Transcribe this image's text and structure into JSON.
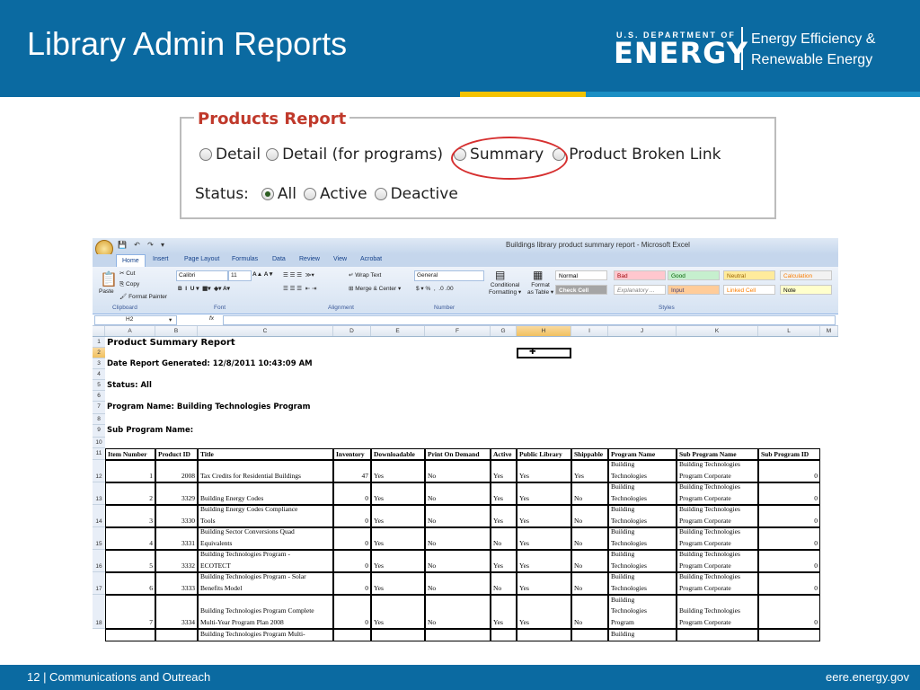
{
  "slide": {
    "title": "Library Admin Reports",
    "logo_small": "U.S. DEPARTMENT OF",
    "logo_big": "ENERGY",
    "eere_line1": "Energy Efficiency &",
    "eere_line2": "Renewable Energy",
    "footer_left": "12 | Communications and Outreach",
    "footer_right": "eere.energy.gov"
  },
  "products_report": {
    "legend": "Products Report",
    "options": [
      "Detail",
      "Detail (for programs)",
      "Summary",
      "Product Broken Link"
    ],
    "status_label": "Status:",
    "status_options": [
      "All",
      "Active",
      "Deactive"
    ],
    "selected_status": "All"
  },
  "excel": {
    "window_title": "Buildings library product summary report - Microsoft Excel",
    "tabs": [
      "Home",
      "Insert",
      "Page Layout",
      "Formulas",
      "Data",
      "Review",
      "View",
      "Acrobat"
    ],
    "ribbon": {
      "paste": "Paste",
      "cut": "Cut",
      "copy": "Copy",
      "format_painter": "Format Painter",
      "font_name": "Calibri",
      "font_size": "11",
      "wrap_text": "Wrap Text",
      "merge_center": "Merge & Center",
      "number_format": "General",
      "conditional": "Conditional",
      "formatting": "Formatting",
      "format": "Format",
      "as_table": "as Table",
      "groups": [
        "Clipboard",
        "Font",
        "Alignment",
        "Number",
        "Styles"
      ],
      "styles": [
        {
          "label": "Normal",
          "bg": "#ffffff",
          "fg": "#000000"
        },
        {
          "label": "Bad",
          "bg": "#ffc7ce",
          "fg": "#9c0006"
        },
        {
          "label": "Good",
          "bg": "#c6efce",
          "fg": "#006100"
        },
        {
          "label": "Neutral",
          "bg": "#ffeb9c",
          "fg": "#9c6500"
        },
        {
          "label": "Calculation",
          "bg": "#f2f2f2",
          "fg": "#fa7d00"
        },
        {
          "label": "Check Cell",
          "bg": "#a5a5a5",
          "fg": "#ffffff"
        },
        {
          "label": "Explanatory ...",
          "bg": "#ffffff",
          "fg": "#7f7f7f"
        },
        {
          "label": "Input",
          "bg": "#ffcc99",
          "fg": "#3f3f76"
        },
        {
          "label": "Linked Cell",
          "bg": "#ffffff",
          "fg": "#fa7d00"
        },
        {
          "label": "Note",
          "bg": "#ffffcc",
          "fg": "#000000"
        }
      ]
    },
    "name_box": "H2",
    "fx": "fx",
    "columns": [
      "A",
      "B",
      "C",
      "D",
      "E",
      "F",
      "G",
      "H",
      "I",
      "J",
      "K",
      "L",
      "M"
    ],
    "selected_column": "H",
    "row_numbers": [
      "1",
      "2",
      "3",
      "4",
      "5",
      "6",
      "7",
      "8",
      "9",
      "10",
      "11",
      "12",
      "13",
      "14",
      "15",
      "16",
      "17",
      "18"
    ],
    "report_title": "Product Summary Report",
    "date_line": "Date Report Generated: 12/8/2011 10:43:09 AM",
    "status_line": "Status: All",
    "program_line": "Program Name: Building Technologies Program",
    "subprogram_line": "Sub Program Name:",
    "headers": [
      "Item Number",
      "Product ID",
      "Title",
      "Inventory",
      "Downloadable",
      "Print On Demand",
      "Active",
      "Public Library",
      "Shippable",
      "Program Name",
      "Sub Program Name",
      "Sub Program ID"
    ],
    "rows": [
      {
        "item": "1",
        "id": "2008",
        "title": [
          "",
          "Tax Credits for Residential Buildings"
        ],
        "inv": "47",
        "dl": "Yes",
        "pod": "No",
        "active": "Yes",
        "pub": "Yes",
        "ship": "Yes",
        "prog": [
          "Building",
          "Technologies"
        ],
        "sub": [
          "Building Technologies",
          "Program Corporate"
        ],
        "subid": "0"
      },
      {
        "item": "2",
        "id": "3329",
        "title": [
          "",
          "Building Energy Codes"
        ],
        "inv": "0",
        "dl": "Yes",
        "pod": "No",
        "active": "Yes",
        "pub": "Yes",
        "ship": "No",
        "prog": [
          "Building",
          "Technologies"
        ],
        "sub": [
          "Building Technologies",
          "Program Corporate"
        ],
        "subid": "0"
      },
      {
        "item": "3",
        "id": "3330",
        "title": [
          "Building Energy Codes Compliance",
          "Tools"
        ],
        "inv": "0",
        "dl": "Yes",
        "pod": "No",
        "active": "Yes",
        "pub": "Yes",
        "ship": "No",
        "prog": [
          "Building",
          "Technologies"
        ],
        "sub": [
          "Building Technologies",
          "Program Corporate"
        ],
        "subid": "0"
      },
      {
        "item": "4",
        "id": "3331",
        "title": [
          "Building Sector Conversions Quad",
          "Equivalents"
        ],
        "inv": "0",
        "dl": "Yes",
        "pod": "No",
        "active": "No",
        "pub": "Yes",
        "ship": "No",
        "prog": [
          "Building",
          "Technologies"
        ],
        "sub": [
          "Building Technologies",
          "Program Corporate"
        ],
        "subid": "0"
      },
      {
        "item": "5",
        "id": "3332",
        "title": [
          "Building Technologies Program -",
          "ECOTECT"
        ],
        "inv": "0",
        "dl": "Yes",
        "pod": "No",
        "active": "Yes",
        "pub": "Yes",
        "ship": "No",
        "prog": [
          "Building",
          "Technologies"
        ],
        "sub": [
          "Building Technologies",
          "Program Corporate"
        ],
        "subid": "0"
      },
      {
        "item": "6",
        "id": "3333",
        "title": [
          "Building Technologies Program - Solar",
          "Benefits Model"
        ],
        "inv": "0",
        "dl": "Yes",
        "pod": "No",
        "active": "No",
        "pub": "Yes",
        "ship": "No",
        "prog": [
          "Building",
          "Technologies"
        ],
        "sub": [
          "Building Technologies",
          "Program Corporate"
        ],
        "subid": "0"
      },
      {
        "item": "7",
        "id": "3334",
        "title": [
          "Building Technologies Program Complete",
          "Multi-Year Program Plan 2008"
        ],
        "inv": "0",
        "dl": "Yes",
        "pod": "No",
        "active": "Yes",
        "pub": "Yes",
        "ship": "No",
        "prog": [
          "Building",
          "Technologies",
          "Program"
        ],
        "sub": [
          "Building Technologies",
          "Program Corporate"
        ],
        "subid": "0"
      }
    ],
    "partial_row": {
      "title": "Building Technologies Program Multi-",
      "prog": "Building"
    }
  }
}
